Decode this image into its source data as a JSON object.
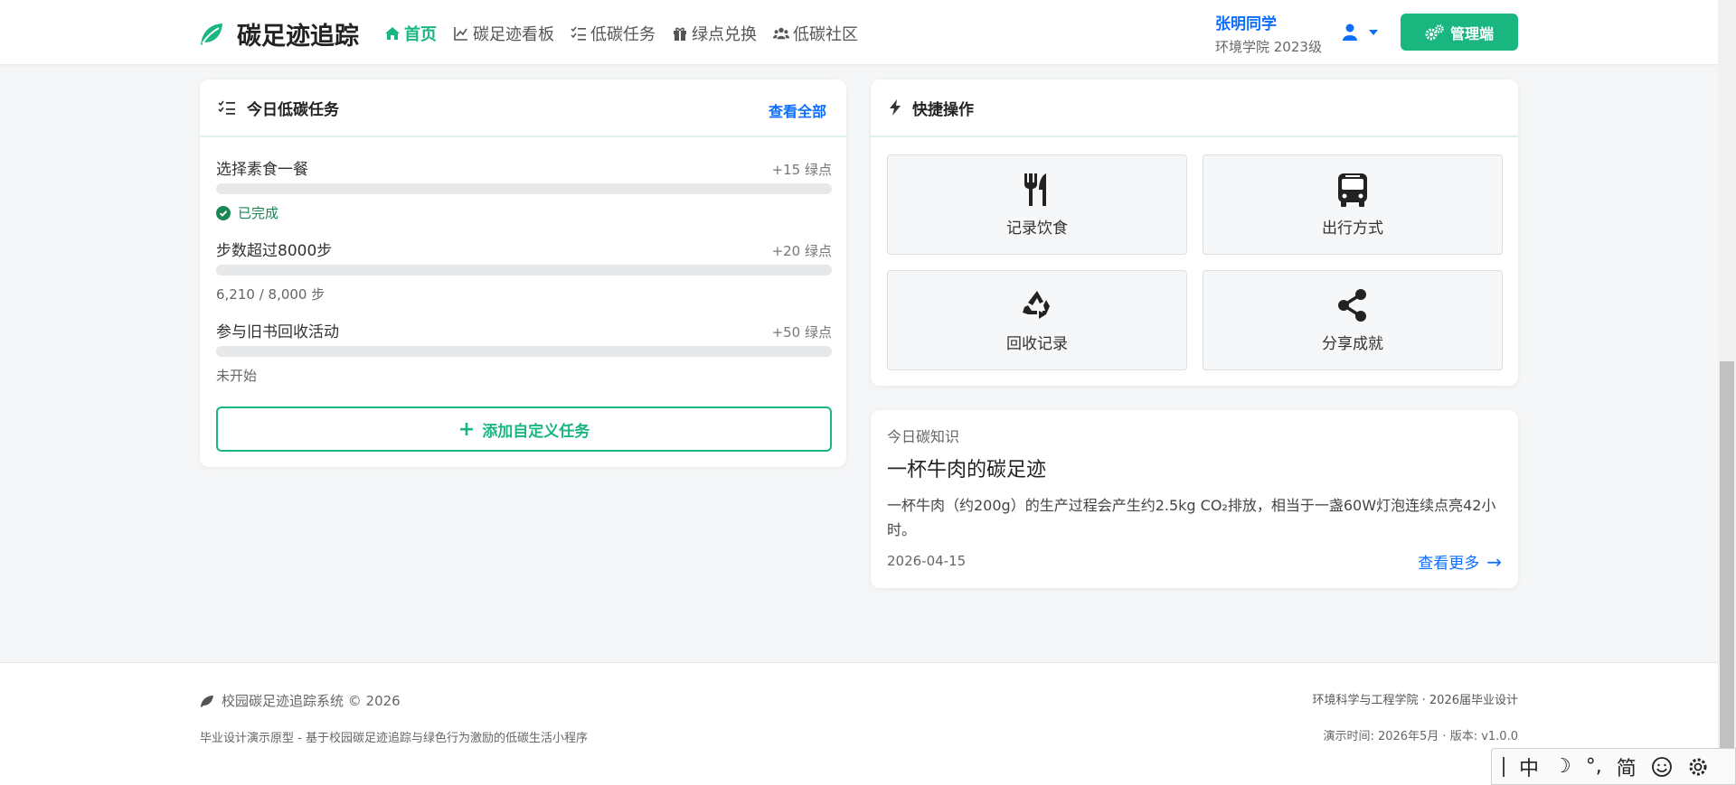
{
  "brand": {
    "name": "碳足迹追踪"
  },
  "nav": [
    {
      "label": "首页",
      "icon": "home-icon",
      "active": true
    },
    {
      "label": "碳足迹看板",
      "icon": "chart-line-icon"
    },
    {
      "label": "低碳任务",
      "icon": "checklist-icon"
    },
    {
      "label": "绿点兑换",
      "icon": "gift-icon"
    },
    {
      "label": "低碳社区",
      "icon": "users-icon"
    }
  ],
  "user": {
    "name": "张明同学",
    "subtitle": "环境学院 2023级"
  },
  "admin_label": "管理端",
  "tasks": {
    "title": "今日低碳任务",
    "view_all": "查看全部",
    "items": [
      {
        "name": "选择素食一餐",
        "points": "+15 绿点",
        "status": "已完成",
        "progress": 0
      },
      {
        "name": "步数超过8000步",
        "points": "+20 绿点",
        "status": "6,210 / 8,000 步",
        "progress": 0
      },
      {
        "name": "参与旧书回收活动",
        "points": "+50 绿点",
        "status": "未开始",
        "progress": 0
      }
    ],
    "add_label": "添加自定义任务"
  },
  "quick": {
    "title": "快捷操作",
    "items": [
      {
        "label": "记录饮食",
        "icon": "utensils-icon"
      },
      {
        "label": "出行方式",
        "icon": "bus-icon"
      },
      {
        "label": "回收记录",
        "icon": "recycle-icon"
      },
      {
        "label": "分享成就",
        "icon": "share-icon"
      }
    ]
  },
  "knowledge": {
    "tag": "今日碳知识",
    "title": "一杯牛肉的碳足迹",
    "body": "一杯牛肉（约200g）的生产过程会产生约2.5kg CO₂排放，相当于一盏60W灯泡连续点亮42小时。",
    "date": "2026-04-15",
    "more": "查看更多"
  },
  "footer": {
    "left1": "校园碳足迹追踪系统 © 2026",
    "left2": "毕业设计演示原型 - 基于校园碳足迹追踪与绿色行为激励的低碳生活小程序",
    "right1": "环境科学与工程学院 · 2026届毕业设计",
    "right2": "演示时间: 2026年5月 · 版本: v1.0.0"
  },
  "ime": {
    "mode": "中",
    "moon": "☽",
    "punct": "°,",
    "script": "简"
  },
  "colors": {
    "accent": "#19b77f",
    "link": "#0d6efd"
  }
}
